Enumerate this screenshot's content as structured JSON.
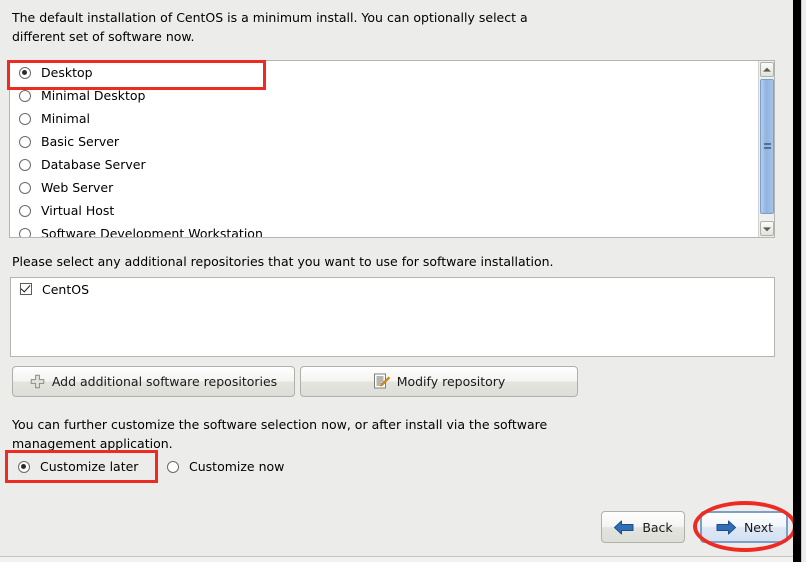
{
  "intro": {
    "line1": "The default installation of CentOS is a minimum install. You can optionally select a",
    "line2": "different set of software now."
  },
  "software_groups": {
    "items": [
      {
        "label": "Desktop",
        "selected": true
      },
      {
        "label": "Minimal Desktop",
        "selected": false
      },
      {
        "label": "Minimal",
        "selected": false
      },
      {
        "label": "Basic Server",
        "selected": false
      },
      {
        "label": "Database Server",
        "selected": false
      },
      {
        "label": "Web Server",
        "selected": false
      },
      {
        "label": "Virtual Host",
        "selected": false
      },
      {
        "label": "Software Development Workstation",
        "selected": false
      }
    ],
    "scrollbar": {
      "up_arrow": "chevron-up-icon",
      "down_arrow": "chevron-down-icon"
    }
  },
  "repositories": {
    "label": "Please select any additional repositories that you want to use for software installation.",
    "items": [
      {
        "label": "CentOS",
        "checked": true
      }
    ],
    "add_button": {
      "label": "Add additional software repositories",
      "icon": "plus-icon"
    },
    "modify_button": {
      "label": "Modify repository",
      "icon": "document-edit-icon"
    }
  },
  "customize": {
    "line1": "You can further customize the software selection now, or after install via the software",
    "line2": "management application.",
    "later": {
      "label": "Customize later",
      "selected": true
    },
    "now": {
      "label": "Customize now",
      "selected": false
    }
  },
  "navigation": {
    "back": {
      "label": "Back",
      "icon": "arrow-left-icon"
    },
    "next": {
      "label": "Next",
      "icon": "arrow-right-icon"
    }
  },
  "colors": {
    "annotation": "#ee2b22",
    "window_background": "#ececeb",
    "list_background": "#ffffff",
    "scrollbar_thumb": "#8fb3e0",
    "nav_arrow": "#2f6fb5",
    "pencil": "#f0a019"
  }
}
